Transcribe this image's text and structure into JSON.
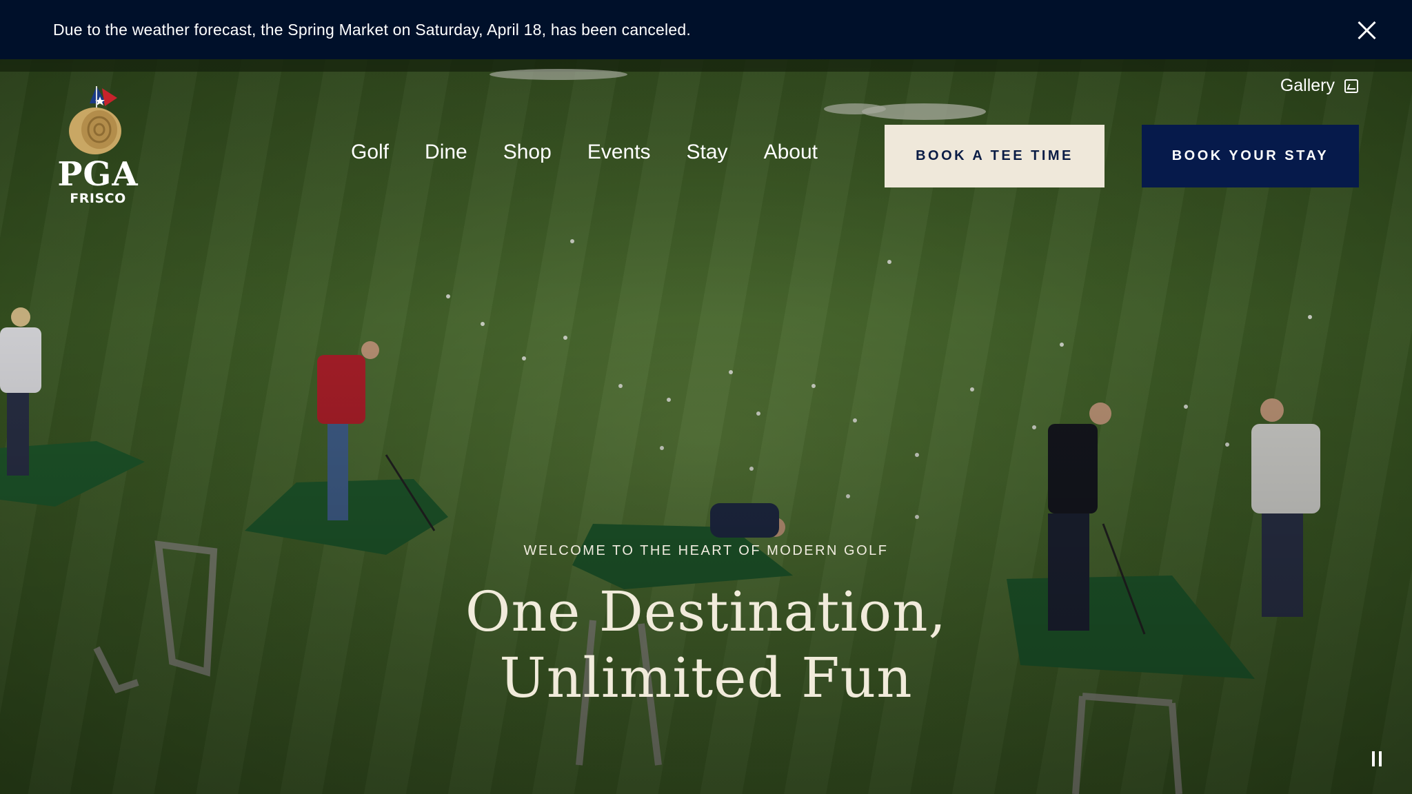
{
  "alert": {
    "message": "Due to the weather forecast, the Spring Market on Saturday, April 18, has been canceled.",
    "close_icon": "close-icon"
  },
  "logo": {
    "wordmark": "PGA",
    "subtitle": "FRISCO"
  },
  "header": {
    "gallery_label": "Gallery",
    "gallery_icon": "image-icon",
    "nav": [
      "Golf",
      "Dine",
      "Shop",
      "Events",
      "Stay",
      "About"
    ],
    "book_tee_time": "BOOK A TEE TIME",
    "book_stay": "BOOK YOUR STAY"
  },
  "hero": {
    "eyebrow": "WELCOME TO THE HEART OF MODERN GOLF",
    "headline_line1": "One Destination,",
    "headline_line2": "Unlimited Fun",
    "pause_icon": "pause-icon"
  },
  "colors": {
    "banner": "#00102a",
    "tee_button": "#efe8da",
    "stay_button": "#061a4b",
    "headline": "#f1ebdb"
  }
}
